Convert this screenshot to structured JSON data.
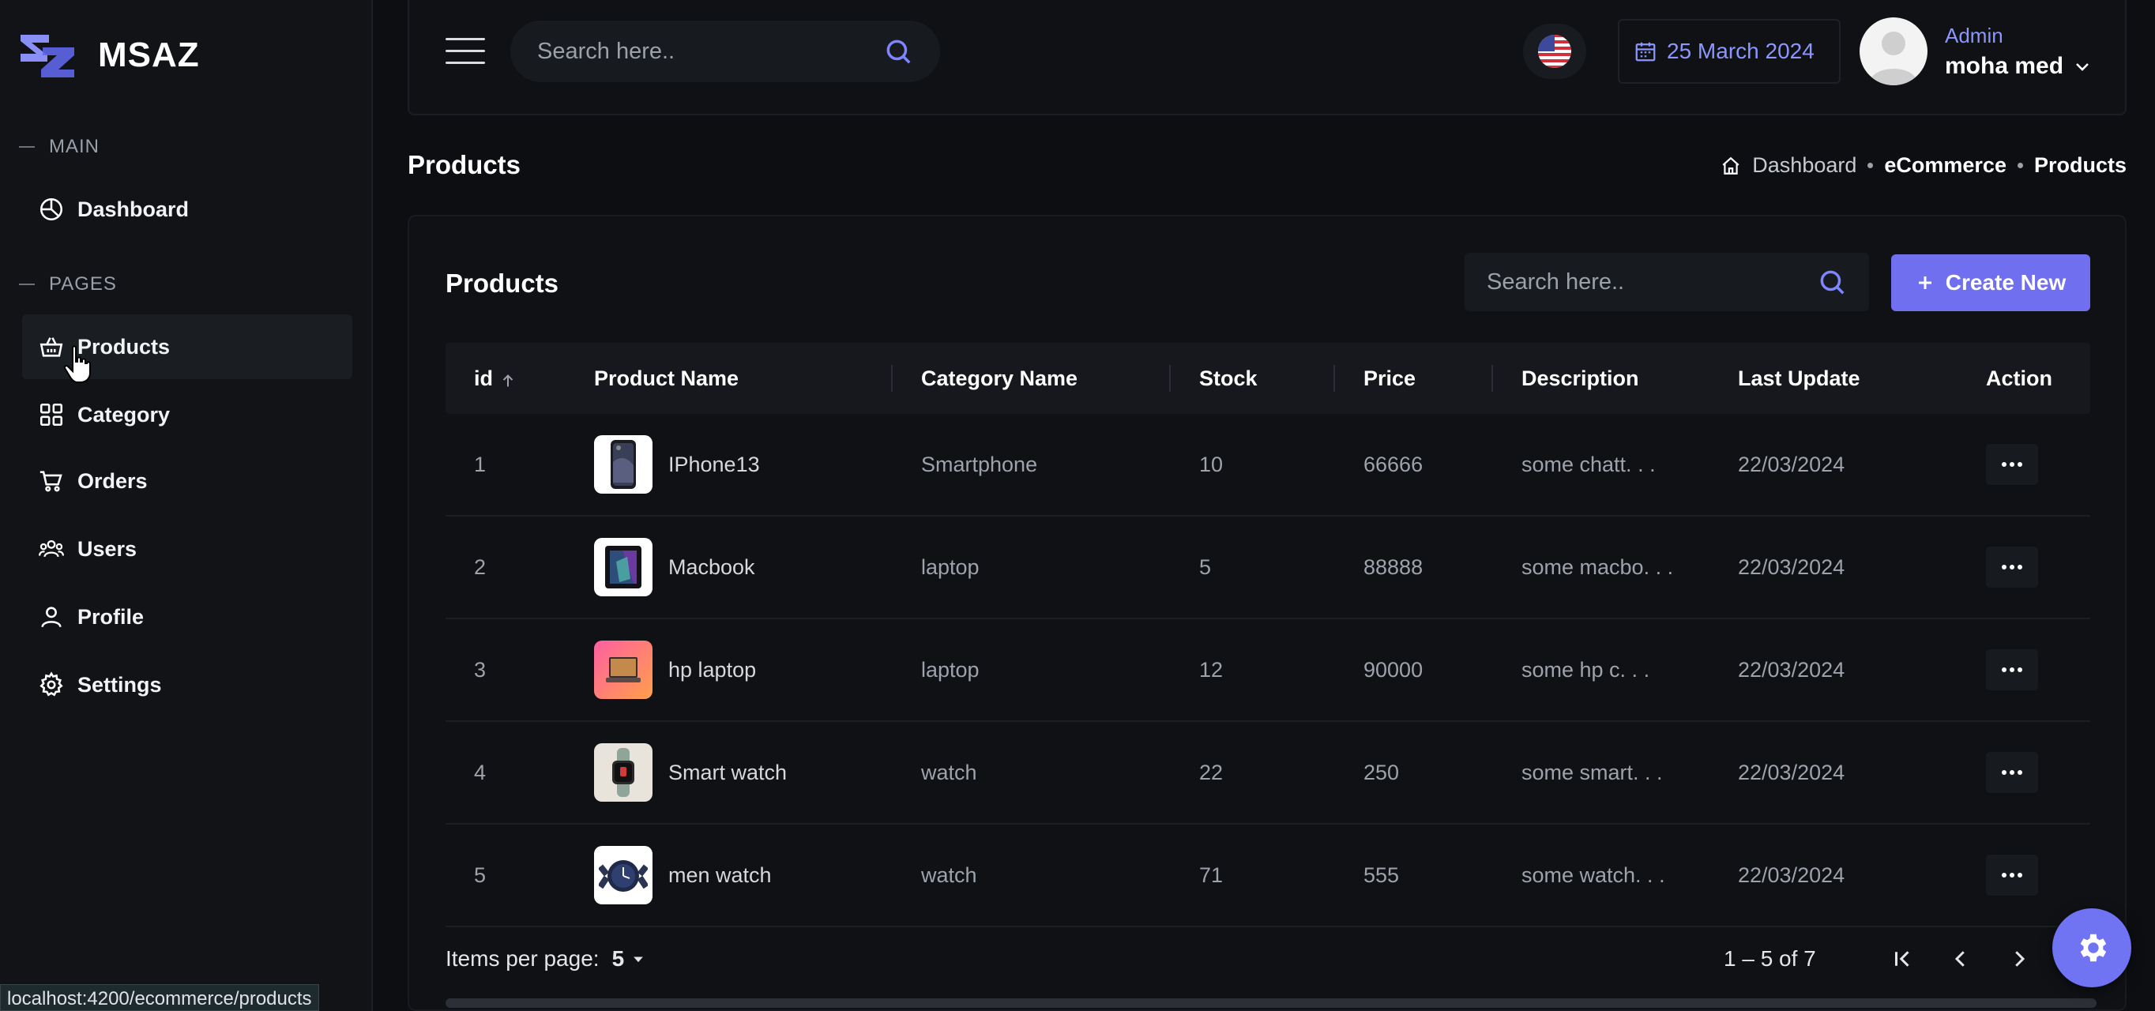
{
  "brand": {
    "name": "MSAZ"
  },
  "sidebar": {
    "sections": [
      {
        "label": "MAIN",
        "items": [
          {
            "label": "Dashboard",
            "icon": "dashboard-icon"
          }
        ]
      },
      {
        "label": "PAGES",
        "items": [
          {
            "label": "Products",
            "icon": "basket-icon",
            "active": true
          },
          {
            "label": "Category",
            "icon": "grid-icon"
          },
          {
            "label": "Orders",
            "icon": "cart-icon"
          },
          {
            "label": "Users",
            "icon": "users-icon"
          },
          {
            "label": "Profile",
            "icon": "user-icon"
          },
          {
            "label": "Settings",
            "icon": "gear-icon"
          }
        ]
      }
    ]
  },
  "header": {
    "search_placeholder": "Search here..",
    "date": "25 March 2024",
    "user": {
      "role": "Admin",
      "name": "moha med"
    },
    "language_flag": "us-flag-icon"
  },
  "page": {
    "title": "Products",
    "breadcrumb": [
      "Dashboard",
      "eCommerce",
      "Products"
    ]
  },
  "card": {
    "title": "Products",
    "search_placeholder": "Search here..",
    "create_label": "Create New"
  },
  "table": {
    "columns": [
      "id",
      "Product Name",
      "Category Name",
      "Stock",
      "Price",
      "Description",
      "Last Update",
      "Action"
    ],
    "rows": [
      {
        "id": "1",
        "name": "IPhone13",
        "category": "Smartphone",
        "stock": "10",
        "price": "66666",
        "description": "some chatt. . .",
        "updated": "22/03/2024",
        "thumb": "phone"
      },
      {
        "id": "2",
        "name": "Macbook",
        "category": "laptop",
        "stock": "5",
        "price": "88888",
        "description": "some macbo. . .",
        "updated": "22/03/2024",
        "thumb": "macbook"
      },
      {
        "id": "3",
        "name": "hp laptop",
        "category": "laptop",
        "stock": "12",
        "price": "90000",
        "description": "some hp c. . .",
        "updated": "22/03/2024",
        "thumb": "hp"
      },
      {
        "id": "4",
        "name": "Smart watch",
        "category": "watch",
        "stock": "22",
        "price": "250",
        "description": "some smart. . .",
        "updated": "22/03/2024",
        "thumb": "smartwatch"
      },
      {
        "id": "5",
        "name": "men watch",
        "category": "watch",
        "stock": "71",
        "price": "555",
        "description": "some watch. . .",
        "updated": "22/03/2024",
        "thumb": "menwatch"
      }
    ]
  },
  "paginator": {
    "items_per_page_label": "Items per page:",
    "items_per_page": "5",
    "range": "1 – 5 of 7"
  },
  "status_bar": {
    "url": "localhost:4200/ecommerce/products"
  },
  "colors": {
    "accent": "#6f6ff0",
    "accent_text": "#8c96ff",
    "background": "#0c0e12"
  }
}
